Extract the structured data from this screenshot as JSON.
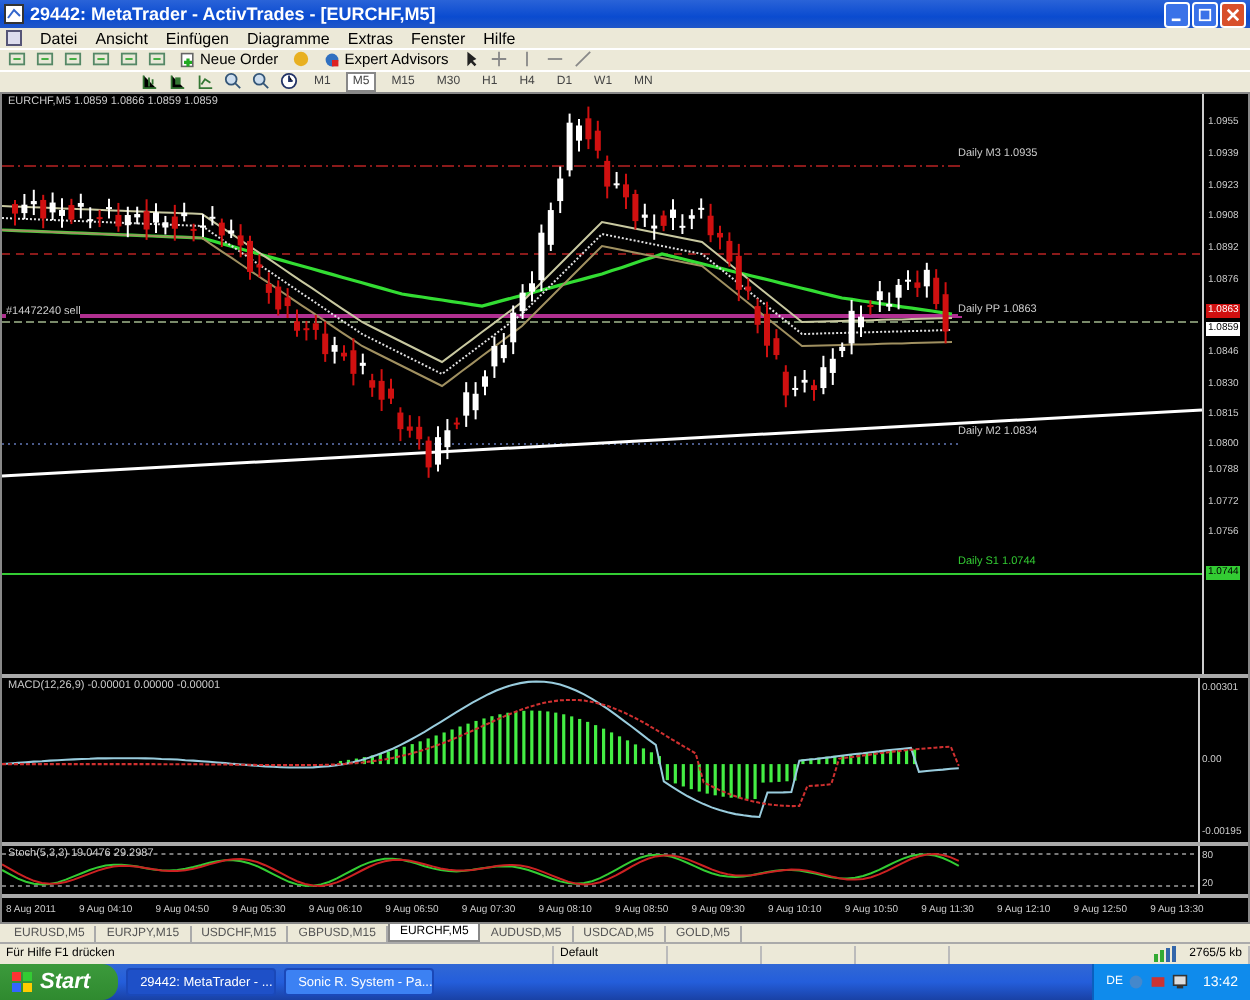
{
  "window": {
    "title": "29442: MetaTrader - ActivTrades - [EURCHF,M5]"
  },
  "menu": [
    "Datei",
    "Ansicht",
    "Einfügen",
    "Diagramme",
    "Extras",
    "Fenster",
    "Hilfe"
  ],
  "toolbar": {
    "new_order": "Neue Order",
    "expert_advisors": "Expert Advisors"
  },
  "timeframes": [
    {
      "label": "M1",
      "selected": false
    },
    {
      "label": "M5",
      "selected": true
    },
    {
      "label": "M15",
      "selected": false
    },
    {
      "label": "M30",
      "selected": false
    },
    {
      "label": "H1",
      "selected": false
    },
    {
      "label": "H4",
      "selected": false
    },
    {
      "label": "D1",
      "selected": false
    },
    {
      "label": "W1",
      "selected": false
    },
    {
      "label": "MN",
      "selected": false
    }
  ],
  "chart": {
    "header": "EURCHF,M5  1.0859 1.0866 1.0859 1.0859",
    "order_label": "#14472240 sell",
    "levels": [
      {
        "label": "Daily M3 1.0935",
        "kind": "mid"
      },
      {
        "label": "Daily PP 1.0863",
        "kind": "pivot"
      },
      {
        "label": "Daily M2 1.0834",
        "kind": "mid"
      },
      {
        "label": "Daily S1 1.0744",
        "kind": "support"
      }
    ],
    "price_axis": [
      {
        "label": "1.0955",
        "kind": "plain"
      },
      {
        "label": "1.0939",
        "kind": "plain"
      },
      {
        "label": "1.0923",
        "kind": "plain"
      },
      {
        "label": "1.0908",
        "kind": "plain"
      },
      {
        "label": "1.0892",
        "kind": "plain"
      },
      {
        "label": "1.0876",
        "kind": "plain"
      },
      {
        "label": "1.0863",
        "kind": "ask"
      },
      {
        "label": "1.0859",
        "kind": "bid"
      },
      {
        "label": "1.0846",
        "kind": "plain"
      },
      {
        "label": "1.0830",
        "kind": "plain"
      },
      {
        "label": "1.0815",
        "kind": "plain"
      },
      {
        "label": "1.0800",
        "kind": "plain"
      },
      {
        "label": "1.0788",
        "kind": "plain"
      },
      {
        "label": "1.0772",
        "kind": "plain"
      },
      {
        "label": "1.0756",
        "kind": "plain"
      },
      {
        "label": "1.0744",
        "kind": "level"
      }
    ]
  },
  "macd": {
    "header": "MACD(12,26,9) -0.00001 0.00000 -0.00001",
    "axis": [
      "0.00301",
      "0.00",
      "-0.00195"
    ]
  },
  "stochastic": {
    "header": "Stoch(5,3,3) 19.0476 29.2987",
    "axis": [
      "80",
      "20"
    ]
  },
  "time_axis": [
    "8 Aug 2011",
    "9 Aug 04:10",
    "9 Aug 04:50",
    "9 Aug 05:30",
    "9 Aug 06:10",
    "9 Aug 06:50",
    "9 Aug 07:30",
    "9 Aug 08:10",
    "9 Aug 08:50",
    "9 Aug 09:30",
    "9 Aug 10:10",
    "9 Aug 10:50",
    "9 Aug 11:30",
    "9 Aug 12:10",
    "9 Aug 12:50",
    "9 Aug 13:30"
  ],
  "chart_tabs": [
    {
      "label": "EURUSD,M5",
      "selected": false
    },
    {
      "label": "EURJPY,M15",
      "selected": false
    },
    {
      "label": "USDCHF,M15",
      "selected": false
    },
    {
      "label": "GBPUSD,M15",
      "selected": false
    },
    {
      "label": "EURCHF,M5",
      "selected": true
    },
    {
      "label": "AUDUSD,M5",
      "selected": false
    },
    {
      "label": "USDCAD,M5",
      "selected": false
    },
    {
      "label": "GOLD,M5",
      "selected": false
    }
  ],
  "status_bar": {
    "help": "Für Hilfe F1 drücken",
    "profile": "Default",
    "traffic": "2765/5 kb"
  },
  "taskbar": {
    "start": "Start",
    "tasks": [
      "29442: MetaTrader - ...",
      "Sonic R. System - Pa..."
    ],
    "language": "DE",
    "clock": "13:42"
  }
}
